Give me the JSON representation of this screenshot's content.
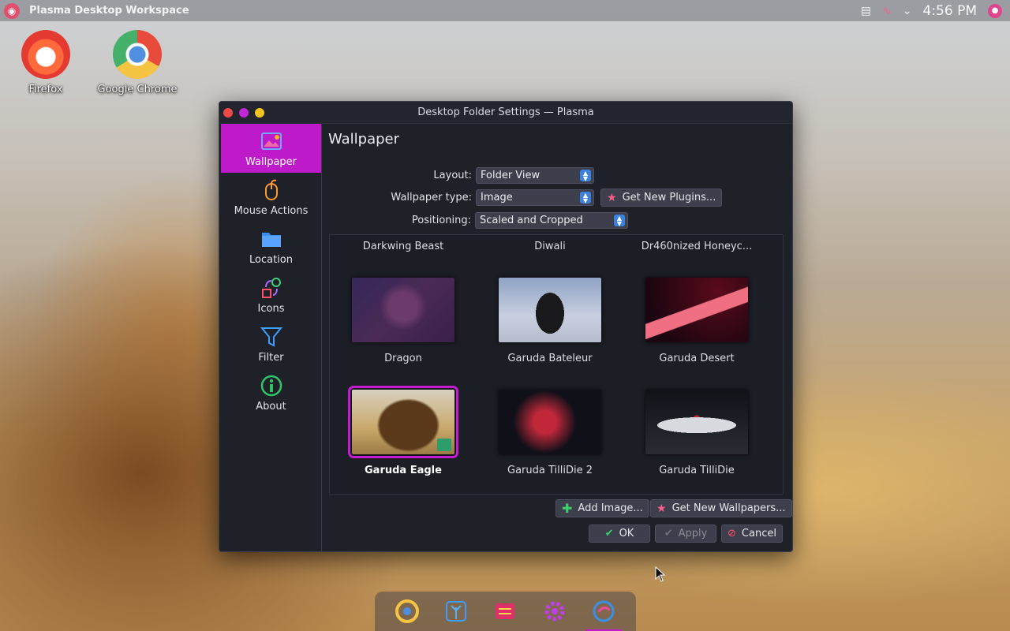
{
  "topbar": {
    "title": "Plasma Desktop Workspace",
    "clock": "4:56 PM",
    "icons": [
      "garuda-logo-icon",
      "clipboard-icon",
      "audio-icon",
      "chevron-down-icon",
      "user-icon"
    ]
  },
  "desktop": {
    "icons": [
      {
        "label": "Firefox",
        "icon": "firefox-icon"
      },
      {
        "label": "Google Chrome",
        "icon": "chrome-icon"
      }
    ]
  },
  "window": {
    "title": "Desktop Folder Settings — Plasma",
    "sidebar": [
      {
        "label": "Wallpaper",
        "icon": "wallpaper-icon",
        "active": true
      },
      {
        "label": "Mouse Actions",
        "icon": "mouse-icon"
      },
      {
        "label": "Location",
        "icon": "folder-icon"
      },
      {
        "label": "Icons",
        "icon": "icons-icon"
      },
      {
        "label": "Filter",
        "icon": "filter-icon"
      },
      {
        "label": "About",
        "icon": "info-icon"
      }
    ],
    "heading": "Wallpaper",
    "form": {
      "layout_label": "Layout:",
      "layout_value": "Folder View",
      "type_label": "Wallpaper type:",
      "type_value": "Image",
      "get_plugins": "Get New Plugins...",
      "positioning_label": "Positioning:",
      "positioning_value": "Scaled and Cropped"
    },
    "wallpapers_top": [
      "Darkwing Beast",
      "Diwali",
      "Dr460nized Honeyc..."
    ],
    "wallpapers": [
      {
        "name": "Dragon",
        "selected": false
      },
      {
        "name": "Garuda Bateleur",
        "selected": false
      },
      {
        "name": "Garuda Desert",
        "selected": false
      },
      {
        "name": "Garuda Eagle",
        "selected": true
      },
      {
        "name": "Garuda TilliDie 2",
        "selected": false
      },
      {
        "name": "Garuda TilliDie",
        "selected": false
      }
    ],
    "buttons": {
      "add_image": "Add Image...",
      "get_wallpapers": "Get New Wallpapers...",
      "ok": "OK",
      "apply": "Apply",
      "cancel": "Cancel"
    }
  },
  "dock": {
    "items": [
      "chrome-icon",
      "garuda-tree-icon",
      "settings-sliders-icon",
      "gear-icon",
      "garuda-icon"
    ]
  },
  "colors": {
    "accent": "#c21bd0",
    "window_bg": "#1f2129",
    "close": "#f14848",
    "minimize": "#c026d3",
    "maximize": "#f5c518"
  }
}
